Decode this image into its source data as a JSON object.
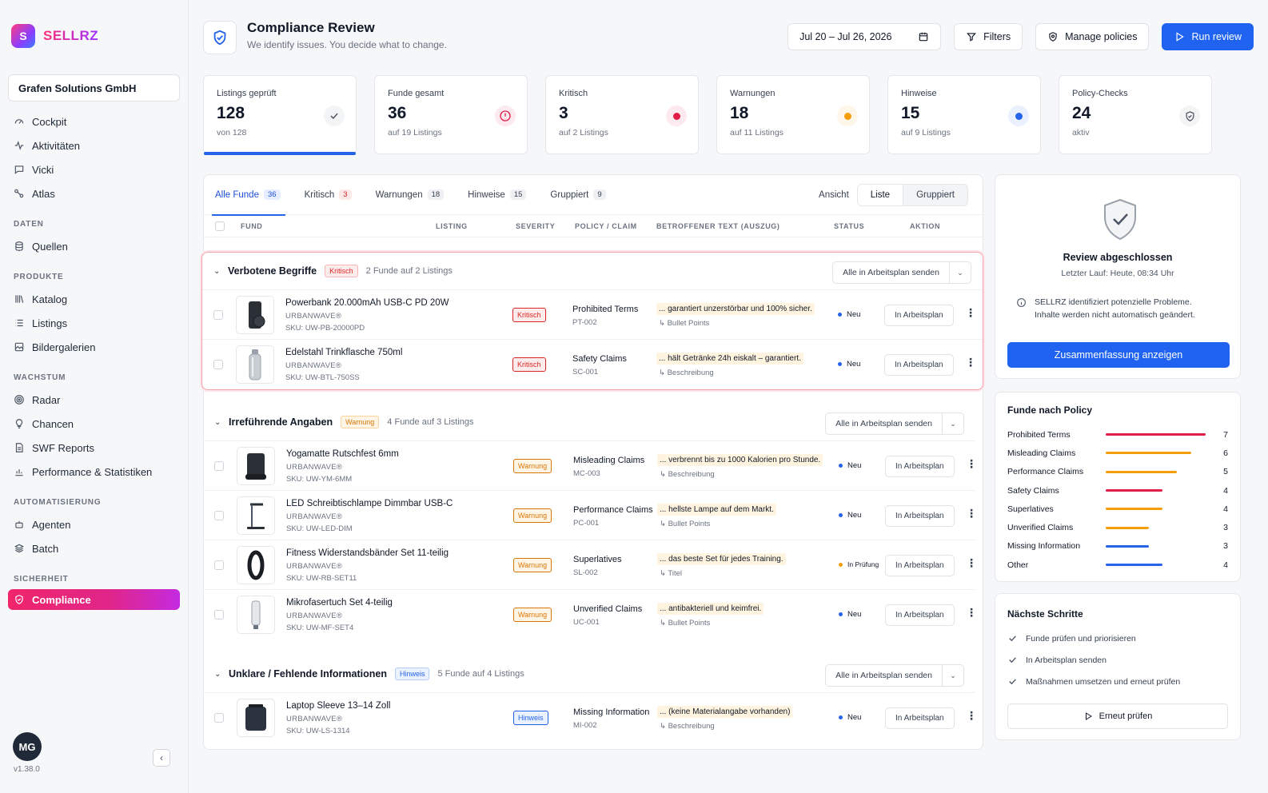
{
  "brand": {
    "logo_letter": "S",
    "name": "SELLRZ"
  },
  "org": "Grafen Solutions GmbH",
  "nav": {
    "main": [
      {
        "label": "Cockpit",
        "icon": "gauge-icon"
      },
      {
        "label": "Aktivitäten",
        "icon": "activity-icon"
      },
      {
        "label": "Vicki",
        "icon": "chat-icon"
      },
      {
        "label": "Atlas",
        "icon": "nodes-icon"
      }
    ],
    "sections": [
      {
        "title": "DATEN",
        "items": [
          {
            "label": "Quellen",
            "icon": "database-icon"
          }
        ]
      },
      {
        "title": "PRODUKTE",
        "items": [
          {
            "label": "Katalog",
            "icon": "library-icon"
          },
          {
            "label": "Listings",
            "icon": "list-icon"
          },
          {
            "label": "Bildergalerien",
            "icon": "image-icon"
          }
        ]
      },
      {
        "title": "WACHSTUM",
        "items": [
          {
            "label": "Radar",
            "icon": "radar-icon"
          },
          {
            "label": "Chancen",
            "icon": "bulb-icon"
          },
          {
            "label": "SWF Reports",
            "icon": "report-icon"
          },
          {
            "label": "Performance & Statistiken",
            "icon": "chart-icon"
          }
        ]
      },
      {
        "title": "AUTOMATISIERUNG",
        "items": [
          {
            "label": "Agenten",
            "icon": "bot-icon"
          },
          {
            "label": "Batch",
            "icon": "layers-icon"
          }
        ]
      },
      {
        "title": "SICHERHEIT",
        "items": [
          {
            "label": "Compliance",
            "icon": "shield-icon",
            "active": true
          }
        ]
      }
    ]
  },
  "user": {
    "initials": "MG",
    "version": "v1.38.0"
  },
  "header": {
    "title": "Compliance Review",
    "subtitle": "We identify issues. You decide what to change.",
    "date_range": "Jul 20 – Jul 26, 2026",
    "filters": "Filters",
    "manage_policies": "Manage policies",
    "run_review": "Run review"
  },
  "kpis": [
    {
      "label": "Listings geprüft",
      "value": "128",
      "sub": "von 128",
      "indicator": "check",
      "color": "#4b5563",
      "progress": 1.0
    },
    {
      "label": "Funde gesamt",
      "value": "36",
      "sub": "auf 19 Listings",
      "indicator": "alert",
      "color": "#e11d48"
    },
    {
      "label": "Kritisch",
      "value": "3",
      "sub": "auf 2 Listings",
      "indicator": "dot",
      "color": "#e11d48"
    },
    {
      "label": "Warnungen",
      "value": "18",
      "sub": "auf 11 Listings",
      "indicator": "dot",
      "color": "#f59e0b"
    },
    {
      "label": "Hinweise",
      "value": "15",
      "sub": "auf 9 Listings",
      "indicator": "dot",
      "color": "#2563eb"
    },
    {
      "label": "Policy-Checks",
      "value": "24",
      "sub": "aktiv",
      "indicator": "shield",
      "color": "#4b5563"
    }
  ],
  "tabs": [
    {
      "label": "Alle Funde",
      "count": "36",
      "active": true
    },
    {
      "label": "Kritisch",
      "count": "3"
    },
    {
      "label": "Warnungen",
      "count": "18"
    },
    {
      "label": "Hinweise",
      "count": "15"
    },
    {
      "label": "Gruppiert",
      "count": "9"
    }
  ],
  "view": {
    "label": "Ansicht",
    "options": [
      "Liste",
      "Gruppiert"
    ],
    "selected": "Liste"
  },
  "columns": [
    "FUND",
    "LISTING",
    "SEVERITY",
    "POLICY / CLAIM",
    "BETROFFENER TEXT (AUSZUG)",
    "STATUS",
    "AKTION"
  ],
  "send_all_label": "Alle in Arbeitsplan senden",
  "action_label": "In Arbeitsplan",
  "groups": [
    {
      "title": "Verbotene Begriffe",
      "severity": "Kritisch",
      "sev_class": "crit",
      "count": "2 Funde auf 2 Listings",
      "rows": [
        {
          "name": "Powerbank 20.000mAh USB-C PD 20W",
          "brand": "URBANWAVE®",
          "sku": "SKU: UW-PB-20000PD",
          "severity": "Kritisch",
          "policy": "Prohibited Terms",
          "policy_id": "PT-002",
          "text": "... garantiert unzerstörbar und 100% sicher.",
          "source": "↳ Bullet Points",
          "status": "Neu",
          "status_color": "#2563eb",
          "thumb": "powerbank"
        },
        {
          "name": "Edelstahl Trinkflasche 750ml",
          "brand": "URBANWAVE®",
          "sku": "SKU: UW-BTL-750SS",
          "severity": "Kritisch",
          "policy": "Safety Claims",
          "policy_id": "SC-001",
          "text": "... hält Getränke 24h eiskalt – garantiert.",
          "source": "↳ Beschreibung",
          "status": "Neu",
          "status_color": "#2563eb",
          "thumb": "bottle"
        }
      ]
    },
    {
      "title": "Irreführende Angaben",
      "severity": "Warnung",
      "sev_class": "warn",
      "count": "4 Funde auf 3 Listings",
      "rows": [
        {
          "name": "Yogamatte Rutschfest 6mm",
          "brand": "URBANWAVE®",
          "sku": "SKU: UW-YM-6MM",
          "severity": "Warnung",
          "policy": "Misleading Claims",
          "policy_id": "MC-003",
          "text": "... verbrennt bis zu 1000 Kalorien pro Stunde.",
          "source": "↳ Beschreibung",
          "status": "Neu",
          "status_color": "#2563eb",
          "thumb": "mat"
        },
        {
          "name": "LED Schreibtischlampe Dimmbar USB-C",
          "brand": "URBANWAVE®",
          "sku": "SKU: UW-LED-DIM",
          "severity": "Warnung",
          "policy": "Performance Claims",
          "policy_id": "PC-001",
          "text": "... hellste Lampe auf dem Markt.",
          "source": "↳ Bullet Points",
          "status": "Neu",
          "status_color": "#2563eb",
          "thumb": "lamp"
        },
        {
          "name": "Fitness Widerstandsbänder Set 11-teilig",
          "brand": "URBANWAVE®",
          "sku": "SKU: UW-RB-SET11",
          "severity": "Warnung",
          "policy": "Superlatives",
          "policy_id": "SL-002",
          "text": "... das beste Set für jedes Training.",
          "source": "↳ Titel",
          "status": "In Prüfung",
          "status_color": "#f59e0b",
          "thumb": "band"
        },
        {
          "name": "Mikrofasertuch Set 4-teilig",
          "brand": "URBANWAVE®",
          "sku": "SKU: UW-MF-SET4",
          "severity": "Warnung",
          "policy": "Unverified Claims",
          "policy_id": "UC-001",
          "text": "... antibakteriell und keimfrei.",
          "source": "↳ Bullet Points",
          "status": "Neu",
          "status_color": "#2563eb",
          "thumb": "tube"
        }
      ]
    },
    {
      "title": "Unklare / Fehlende Informationen",
      "severity": "Hinweis",
      "sev_class": "hint",
      "count": "5 Funde auf 4 Listings",
      "rows": [
        {
          "name": "Laptop Sleeve 13–14 Zoll",
          "brand": "URBANWAVE®",
          "sku": "SKU: UW-LS-1314",
          "severity": "Hinweis",
          "policy": "Missing Information",
          "policy_id": "MI-002",
          "text": "... (keine Materialangabe vorhanden)",
          "source": "↳ Beschreibung",
          "status": "Neu",
          "status_color": "#2563eb",
          "thumb": "sleeve"
        }
      ]
    }
  ],
  "review": {
    "title": "Review abgeschlossen",
    "last_run": "Letzter Lauf: Heute, 08:34 Uhr",
    "info_line1": "SELLRZ identifiziert potenzielle Probleme.",
    "info_line2": "Inhalte werden nicht automatisch geändert.",
    "button": "Zusammenfassung anzeigen"
  },
  "policy_card": {
    "title": "Funde nach Policy",
    "max": 7,
    "items": [
      {
        "name": "Prohibited Terms",
        "count": 7,
        "color": "#e11d48"
      },
      {
        "name": "Misleading Claims",
        "count": 6,
        "color": "#f59e0b"
      },
      {
        "name": "Performance Claims",
        "count": 5,
        "color": "#f59e0b"
      },
      {
        "name": "Safety Claims",
        "count": 4,
        "color": "#e11d48"
      },
      {
        "name": "Superlatives",
        "count": 4,
        "color": "#f59e0b"
      },
      {
        "name": "Unverified Claims",
        "count": 3,
        "color": "#f59e0b"
      },
      {
        "name": "Missing Information",
        "count": 3,
        "color": "#2563eb"
      },
      {
        "name": "Other",
        "count": 4,
        "color": "#2563eb"
      }
    ]
  },
  "next_steps": {
    "title": "Nächste Schritte",
    "items": [
      "Funde prüfen und priorisieren",
      "In Arbeitsplan senden",
      "Maßnahmen umsetzen und erneut prüfen"
    ],
    "button": "Erneut prüfen"
  }
}
